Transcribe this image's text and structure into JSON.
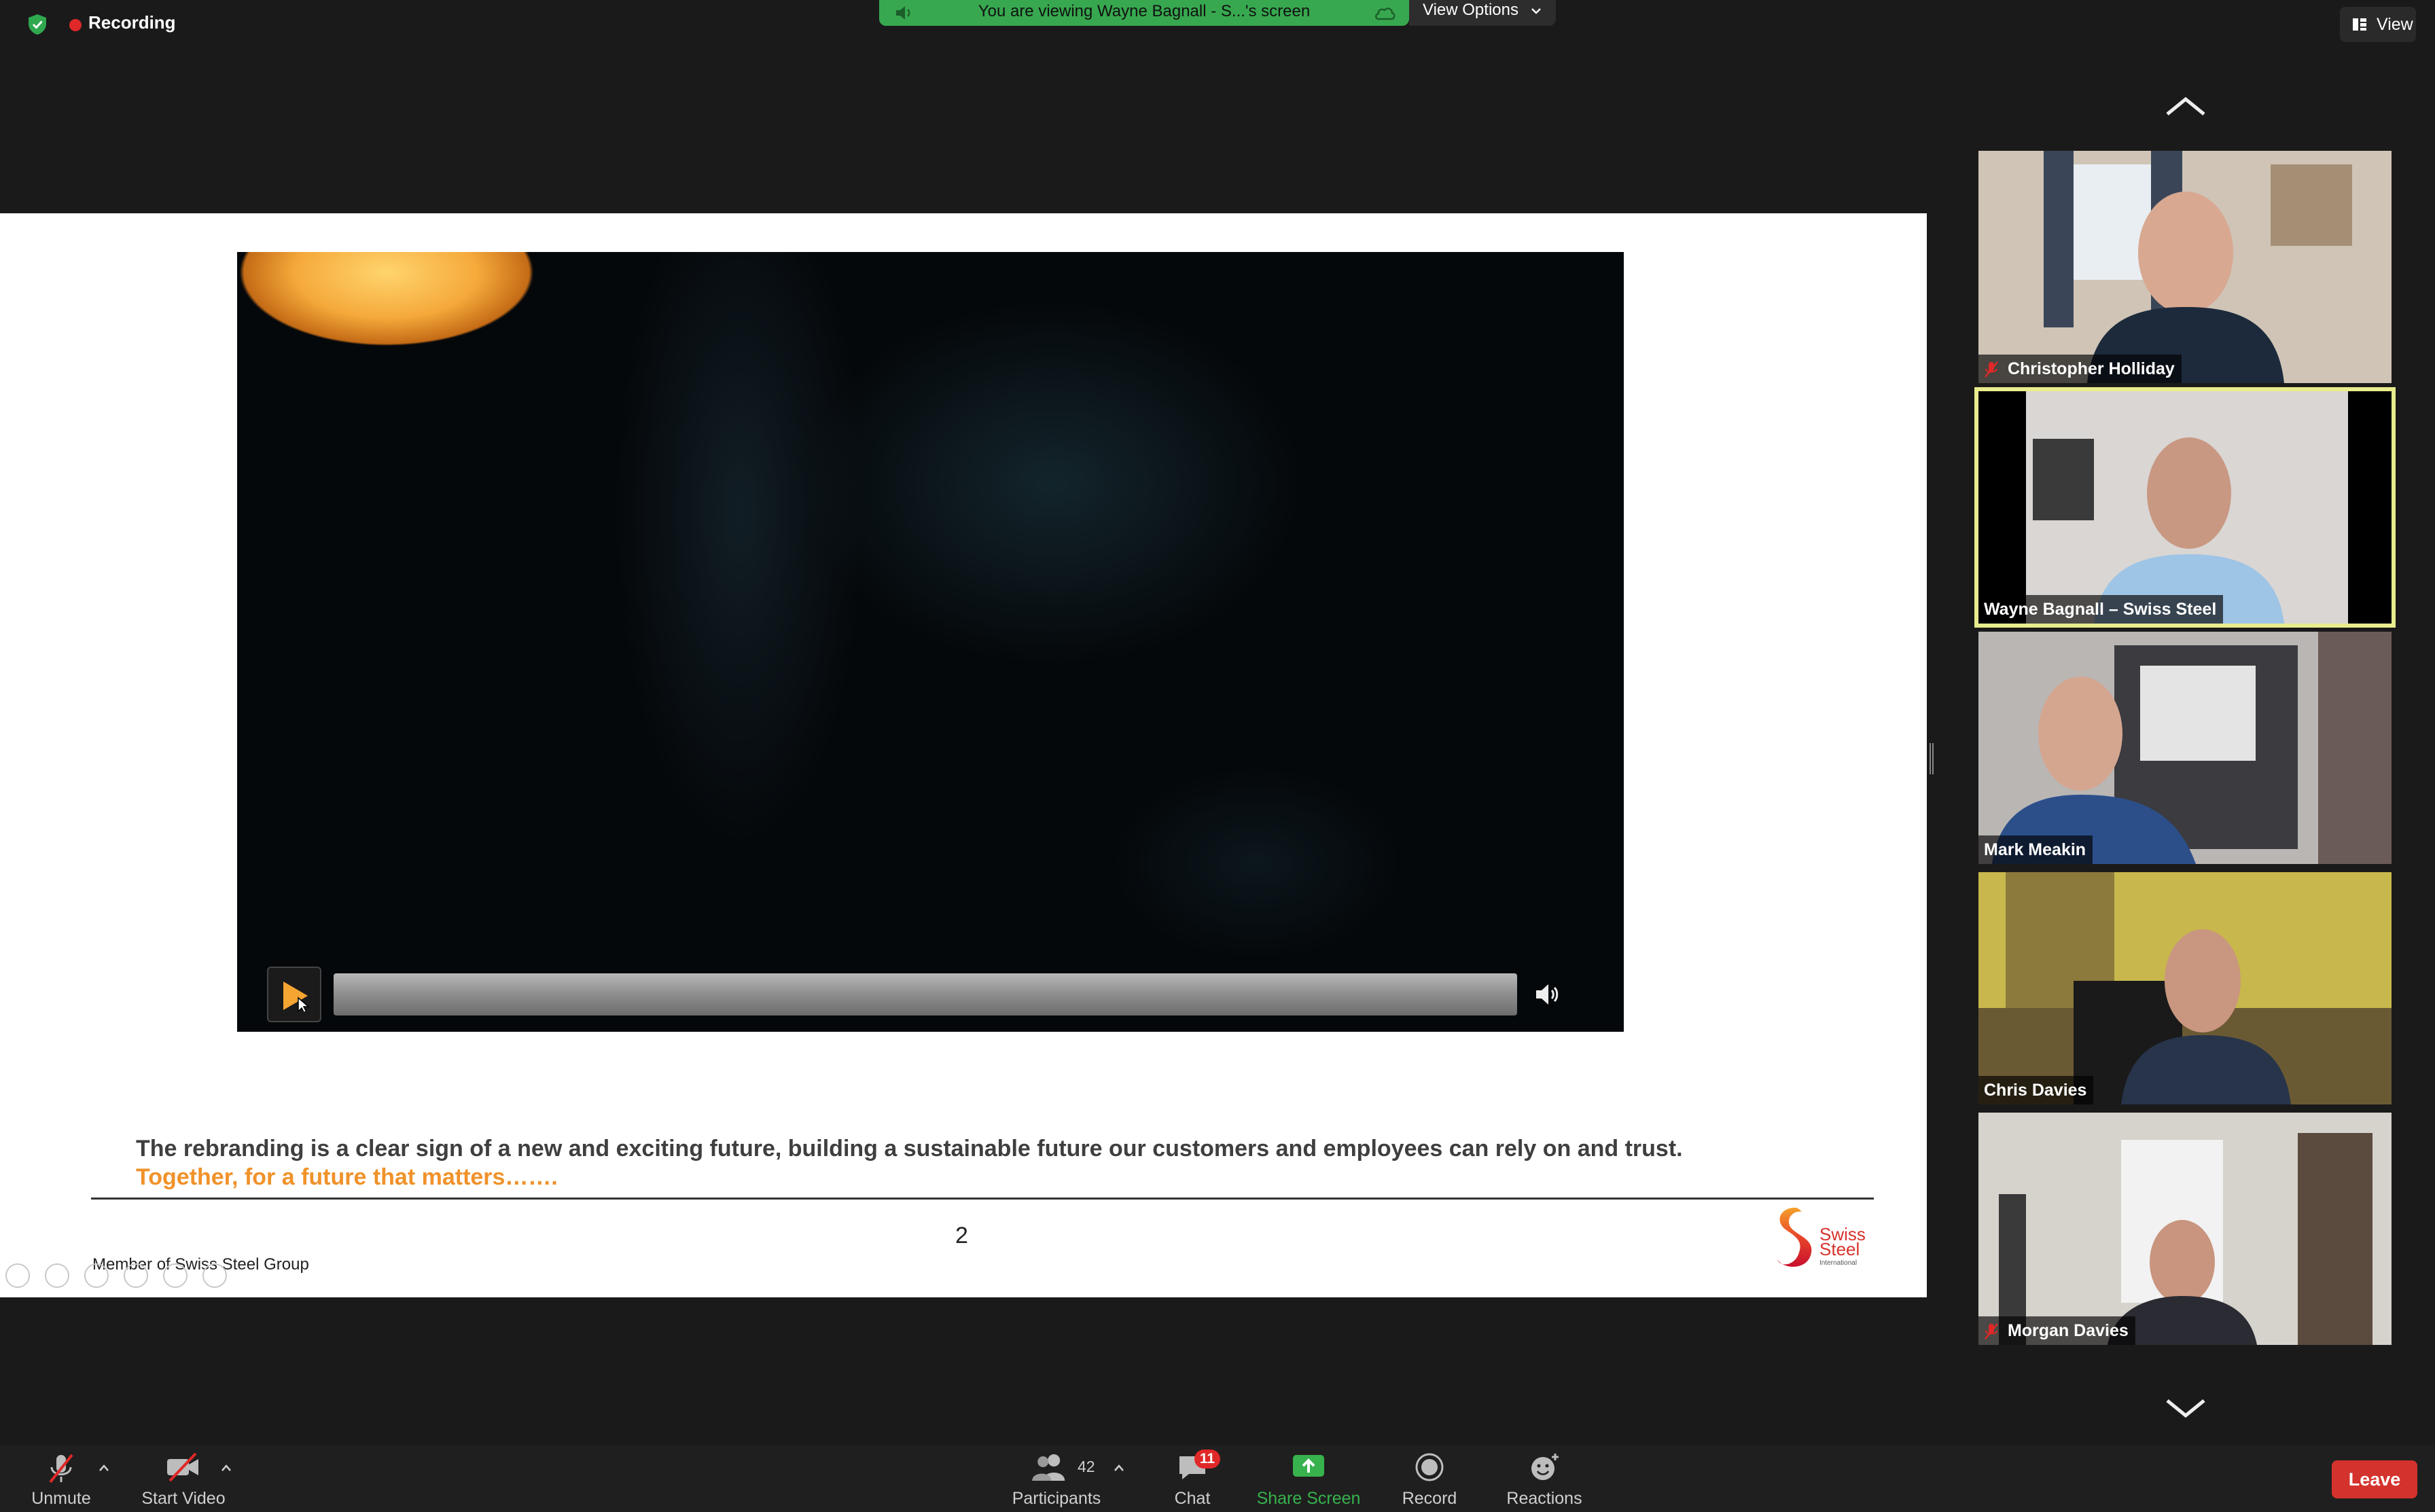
{
  "top_bar": {
    "recording_label": "Recording",
    "viewing_banner": "You are viewing Wayne Bagnall - S...'s screen",
    "view_options_label": "View Options",
    "view_button_label": "View"
  },
  "shared_slide": {
    "caption_line1": "The rebranding is a clear sign of a new and exciting future, building a sustainable future our customers and employees can rely on and trust.",
    "caption_line2": "Together, for a future that matters…….",
    "page_number": "2",
    "footer_text": "Member of Swiss Steel Group",
    "logo_text": [
      "Swiss",
      "Steel",
      "International"
    ]
  },
  "participants_gallery": [
    {
      "name": "Christopher Holliday",
      "muted": true,
      "active": false
    },
    {
      "name": "Wayne Bagnall – Swiss Steel",
      "muted": false,
      "active": true
    },
    {
      "name": "Mark Meakin",
      "muted": false,
      "active": false
    },
    {
      "name": "Chris Davies",
      "muted": false,
      "active": false
    },
    {
      "name": "Morgan Davies",
      "muted": true,
      "active": false
    }
  ],
  "toolbar": {
    "unmute_label": "Unmute",
    "start_video_label": "Start Video",
    "participants_label": "Participants",
    "participants_count": "42",
    "chat_label": "Chat",
    "chat_badge": "11",
    "share_screen_label": "Share Screen",
    "record_label": "Record",
    "reactions_label": "Reactions",
    "leave_label": "Leave"
  },
  "colors": {
    "recording_dot": "#e02828",
    "banner_green": "#37a84f",
    "active_speaker_border": "#e8ec8d",
    "caption_orange": "#f0922a",
    "leave_red": "#d4322c",
    "share_green": "#37b24d"
  }
}
